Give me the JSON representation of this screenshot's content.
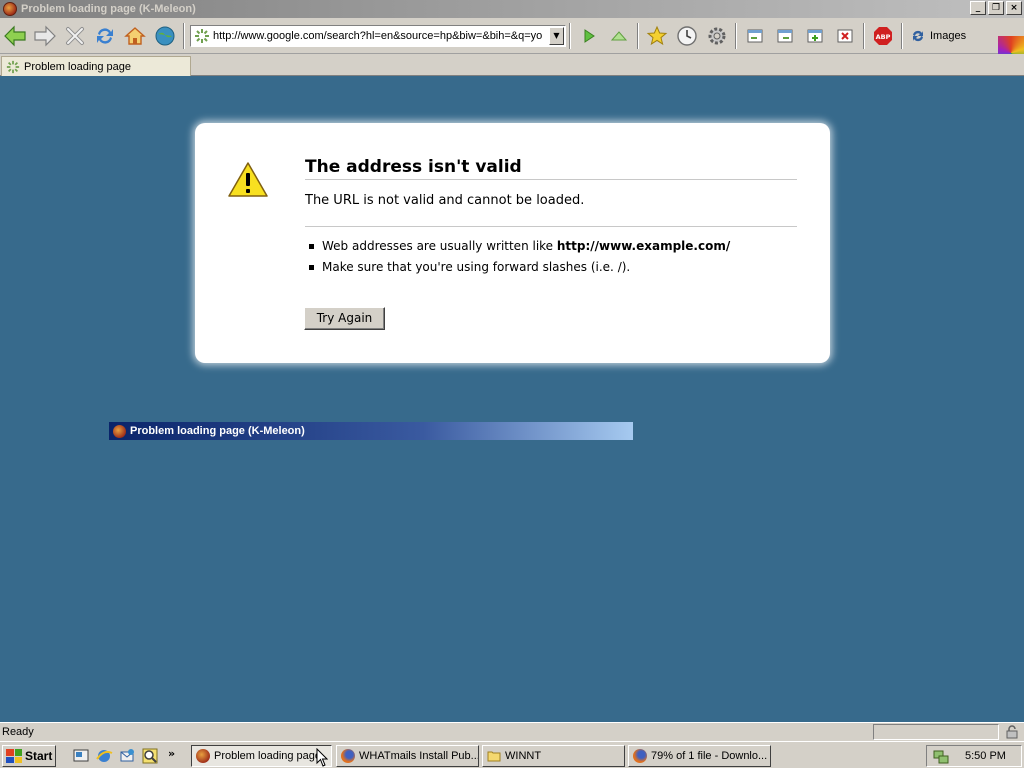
{
  "window": {
    "title": "Problem loading page (K-Meleon)",
    "controls": [
      "_",
      "❐",
      "×"
    ]
  },
  "toolbar": {
    "url": "http://www.google.com/search?hl=en&source=hp&biw=&bih=&q=yo",
    "images_label": "Images"
  },
  "tab": {
    "label": "Problem loading page"
  },
  "error": {
    "title": "The address isn't valid",
    "short_desc": "The URL is not valid and cannot be loaded.",
    "bullet1_text": "Web addresses are usually written like ",
    "bullet1_example": "http://www.example.com/",
    "bullet2_text": "Make sure that you're using forward slashes (i.e. /).",
    "try_again_label": "Try Again"
  },
  "alt_tab": {
    "label": "Problem loading page (K-Meleon)"
  },
  "status": {
    "text": "Ready"
  },
  "taskbar": {
    "start_label": "Start",
    "tasks": [
      {
        "label": "Problem loading page"
      },
      {
        "label": "WHATmails Install Pub..."
      },
      {
        "label": "WINNT"
      },
      {
        "label": "79% of 1 file - Downlo..."
      }
    ],
    "clock": "5:50 PM"
  },
  "colors": {
    "page_background": "#376a8c",
    "accent_blue": "#0a246a"
  }
}
